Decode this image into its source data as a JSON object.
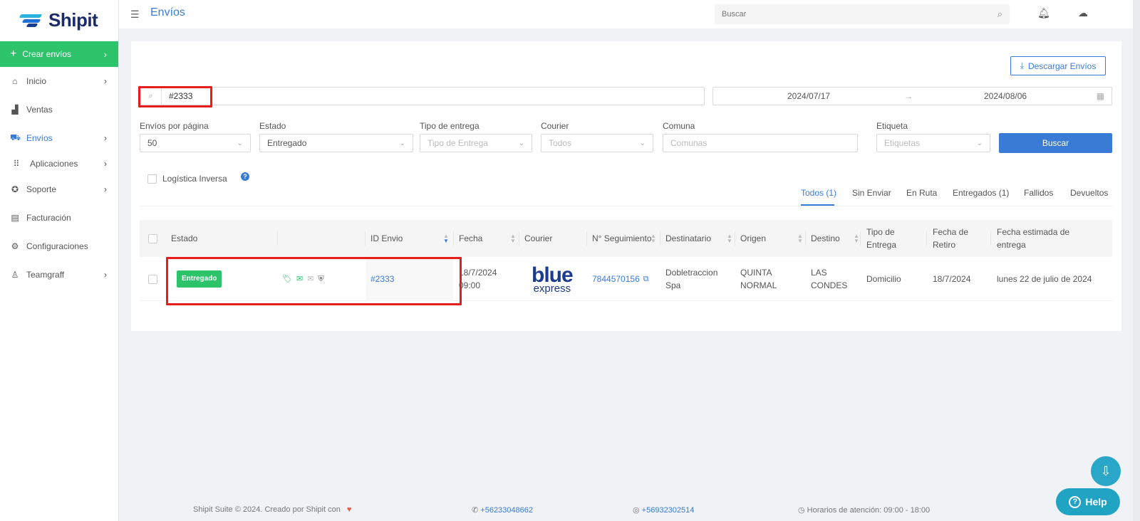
{
  "brand": {
    "name": "Shipit"
  },
  "sidebar": {
    "create": {
      "label": "Crear envíos"
    },
    "items": [
      {
        "label": "Inicio",
        "icon": "home-icon",
        "chevron": true
      },
      {
        "label": "Ventas",
        "icon": "boxes-icon",
        "chevron": false
      },
      {
        "label": "Envíos",
        "icon": "truck-icon",
        "chevron": true,
        "active": true
      },
      {
        "label": "Aplicaciones",
        "icon": "grid-icon",
        "chevron": true
      },
      {
        "label": "Soporte",
        "icon": "lifebuoy-icon",
        "chevron": true
      },
      {
        "label": "Facturación",
        "icon": "invoice-icon",
        "chevron": false
      },
      {
        "label": "Configuraciones",
        "icon": "gear-icon",
        "chevron": false
      },
      {
        "label": "Teamgraff",
        "icon": "user-icon",
        "chevron": true
      }
    ]
  },
  "topbar": {
    "title": "Envíos",
    "search_placeholder": "Buscar"
  },
  "toolbar": {
    "download_label": "Descargar Envíos"
  },
  "search": {
    "value": "#2333"
  },
  "daterange": {
    "start": "2024/07/17",
    "end": "2024/08/06"
  },
  "filters": {
    "per_page": {
      "label": "Envíos por página",
      "value": "50"
    },
    "estado": {
      "label": "Estado",
      "value": "Entregado"
    },
    "tipo_entrega": {
      "label": "Tipo de entrega",
      "placeholder": "Tipo de Entrega"
    },
    "courier": {
      "label": "Courier",
      "placeholder": "Todos"
    },
    "comuna": {
      "label": "Comuna",
      "placeholder": "Comunas"
    },
    "etiqueta": {
      "label": "Etiqueta",
      "placeholder": "Etiquetas"
    },
    "search_button": "Buscar"
  },
  "logistica_inversa": {
    "label": "Logística Inversa",
    "checked": false
  },
  "tabs": [
    {
      "label": "Todos (1)",
      "active": true
    },
    {
      "label": "Sin Enviar"
    },
    {
      "label": "En Ruta"
    },
    {
      "label": "Entregados (1)"
    },
    {
      "label": "Fallidos"
    },
    {
      "label": "Devueltos"
    }
  ],
  "table": {
    "columns": {
      "estado": "Estado",
      "id_envio": "ID Envio",
      "fecha": "Fecha",
      "courier": "Courier",
      "seguimiento": "N° Seguimiento",
      "destinatario": "Destinatario",
      "origen": "Origen",
      "destino": "Destino",
      "tipo_entrega": "Tipo de Entrega",
      "fecha_retiro": "Fecha de Retiro",
      "fecha_estimada": "Fecha estimada de entrega"
    },
    "rows": [
      {
        "estado": "Entregado",
        "status_icons": [
          "tag-icon",
          "mail-icon",
          "envelope-icon",
          "shield-icon"
        ],
        "id_envio": "#2333",
        "fecha": "18/7/2024 09:00",
        "courier_logo": {
          "line1": "blue",
          "line2": "express"
        },
        "seguimiento": "7844570156",
        "destinatario": "Dobletraccion Spa",
        "origen": "QUINTA NORMAL",
        "destino": "LAS CONDES",
        "tipo_entrega": "Domicilio",
        "fecha_retiro": "18/7/2024",
        "fecha_estimada": "lunes 22 de julio de 2024"
      }
    ]
  },
  "footer": {
    "copyright": "Shipit Suite © 2024. Creado por Shipit con",
    "phone": "+56233048662",
    "whatsapp": "+56932302514",
    "hours": "Horarios de atención: 09:00 - 18:00",
    "help_label": "Help"
  },
  "colors": {
    "primary": "#3a7bd5",
    "success": "#2cc36b",
    "highlight": "#e81c1c"
  }
}
